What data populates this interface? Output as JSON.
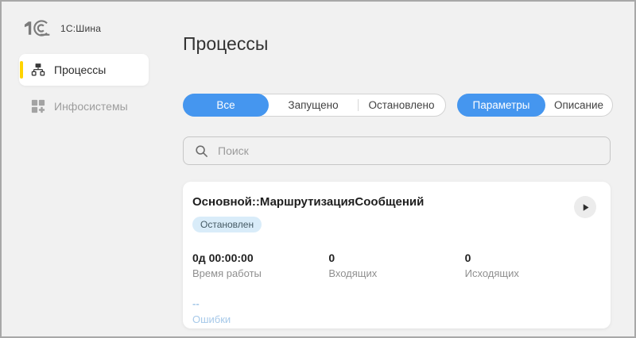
{
  "app": {
    "brand": "1С:Шина"
  },
  "sidebar": {
    "items": [
      {
        "label": "Процессы",
        "selected": true
      },
      {
        "label": "Инфосистемы",
        "selected": false
      }
    ]
  },
  "header": {
    "title": "Процессы"
  },
  "filters": {
    "status_tabs": [
      {
        "label": "Все",
        "selected": true
      },
      {
        "label": "Запущено",
        "selected": false
      },
      {
        "label": "Остановлено",
        "selected": false
      }
    ],
    "view_tabs": [
      {
        "label": "Параметры",
        "selected": true
      },
      {
        "label": "Описание",
        "selected": false
      }
    ]
  },
  "search": {
    "placeholder": "Поиск",
    "value": ""
  },
  "process_card": {
    "title": "Основной::МаршрутизацияСообщений",
    "status_badge": "Остановлен",
    "stats": [
      {
        "value": "0д 00:00:00",
        "label": "Время работы"
      },
      {
        "value": "0",
        "label": "Входящих"
      },
      {
        "value": "0",
        "label": "Исходящих"
      }
    ],
    "errors": {
      "value": "--",
      "label": "Ошибки"
    }
  },
  "colors": {
    "accent_blue": "#4596ef",
    "brand_yellow": "#ffd400",
    "badge_bg": "#d9ecf9",
    "badge_text": "#455a64",
    "link_light_blue": "#a7c9e9",
    "background": "#f1f1f1"
  }
}
